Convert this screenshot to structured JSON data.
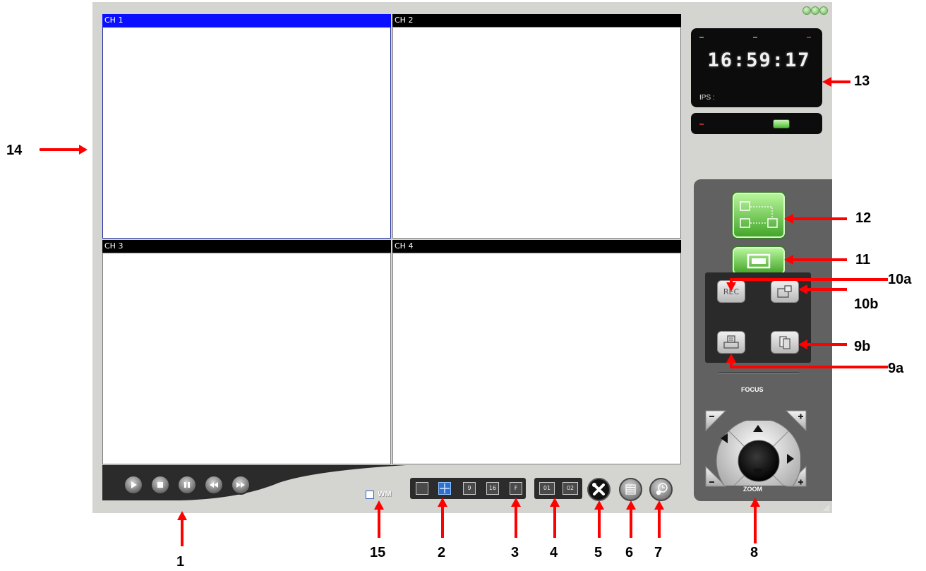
{
  "channels": [
    {
      "title": "CH 1",
      "active": true
    },
    {
      "title": "CH 2",
      "active": false
    },
    {
      "title": "CH 3",
      "active": false
    },
    {
      "title": "CH 4",
      "active": false
    }
  ],
  "clock": {
    "time": "16:59:17",
    "ips_label": "IPS :"
  },
  "watermark": {
    "label": "WM",
    "checked": false
  },
  "layout_buttons": [
    "",
    "",
    "9",
    "16",
    "F"
  ],
  "group_buttons": [
    "01",
    "02"
  ],
  "record_buttons": {
    "rec_label": "REC"
  },
  "ptz": {
    "focus_label": "FOCUS",
    "zoom_label": "ZOOM"
  },
  "icons": {
    "playback": [
      "play-icon",
      "stop-icon",
      "pause-icon",
      "rewind-icon",
      "fast-forward-icon"
    ],
    "tools": [
      "settings-tools-icon",
      "list-icon",
      "schedule-clock-icon"
    ]
  },
  "annotations": {
    "a1": "1",
    "a2": "2",
    "a3": "3",
    "a4": "4",
    "a5": "5",
    "a6": "6",
    "a7": "7",
    "a8": "8",
    "a9a": "9a",
    "a9b": "9b",
    "a10a": "10a",
    "a10b": "10b",
    "a11": "11",
    "a12": "12",
    "a13": "13",
    "a14": "14",
    "a15": "15"
  },
  "colors": {
    "active_channel": "#0a10ff",
    "arrow": "#ff0000",
    "led_green": "#6bd04a"
  }
}
